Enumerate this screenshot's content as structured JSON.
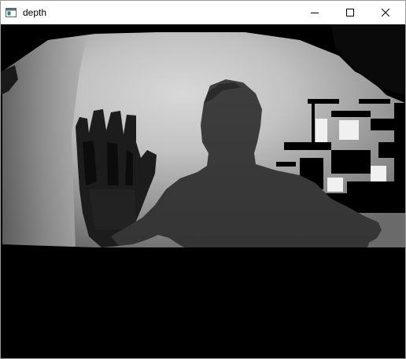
{
  "window": {
    "title": "depth",
    "icons": {
      "app": "app-window-icon",
      "minimize": "minimize-icon",
      "maximize": "maximize-icon",
      "close": "close-icon"
    }
  },
  "image": {
    "description": "depth-map-view",
    "colors": {
      "background": "#000000",
      "far_wall": "#b9b9b9",
      "light_wall": "#cfcfcf",
      "person": "#3a3a3a",
      "hand": "#202020"
    }
  }
}
